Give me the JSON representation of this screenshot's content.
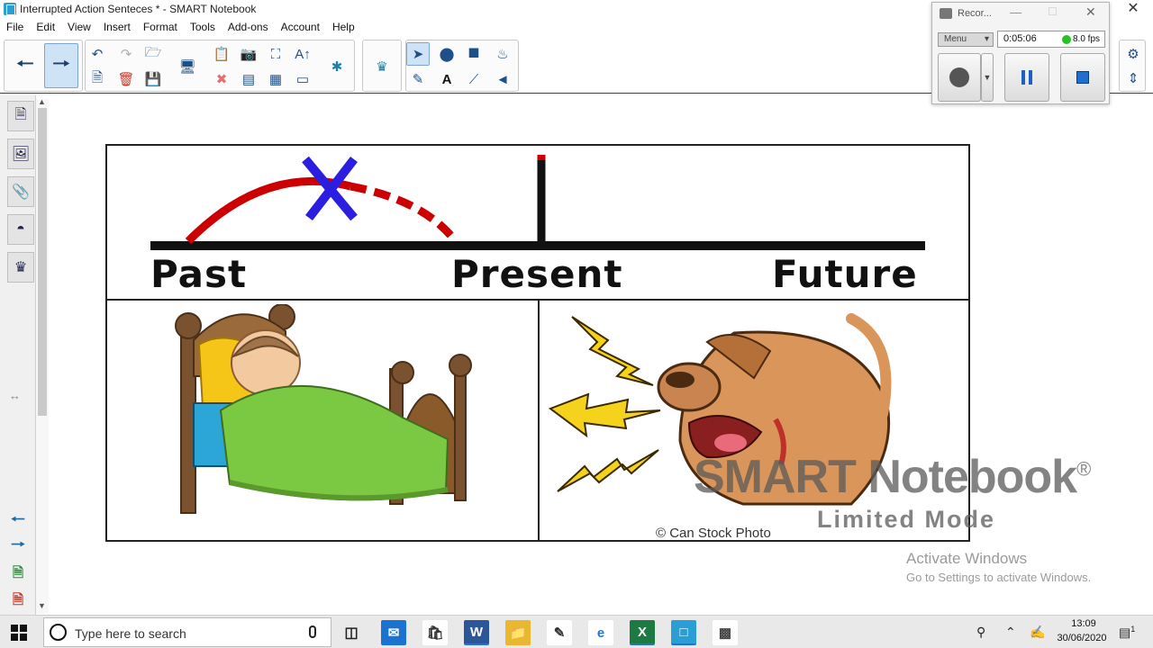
{
  "window": {
    "title": "Interrupted Action Senteces * - SMART Notebook",
    "close_glyph": "✕"
  },
  "menu": [
    "File",
    "Edit",
    "View",
    "Insert",
    "Format",
    "Tools",
    "Add-ons",
    "Account",
    "Help"
  ],
  "toolbar": {
    "back_icon": "arrow-left-icon",
    "forward_icon": "arrow-right-icon"
  },
  "lesson": {
    "timeline_labels": {
      "past": "Past",
      "present": "Present",
      "future": "Future"
    },
    "timeline_colors": {
      "line": "#111111",
      "arc": "#cc0000",
      "x_mark": "#2a1fe0",
      "present_tick": "#cc0000"
    }
  },
  "watermark": {
    "title": "SMART Notebook",
    "registered": "®",
    "subtitle": "Limited Mode",
    "credit": "© Can Stock Photo"
  },
  "activation": {
    "title": "Activate Windows",
    "subtitle": "Go to Settings to activate Windows."
  },
  "recorder": {
    "title": "Recor...",
    "menu_label": "Menu",
    "elapsed": "0:05:06",
    "fps": "8.0 fps",
    "status_color": "#22c322"
  },
  "taskbar": {
    "search_placeholder": "Type here to search",
    "time": "13:09",
    "date": "30/06/2020",
    "notification_count": "1"
  }
}
